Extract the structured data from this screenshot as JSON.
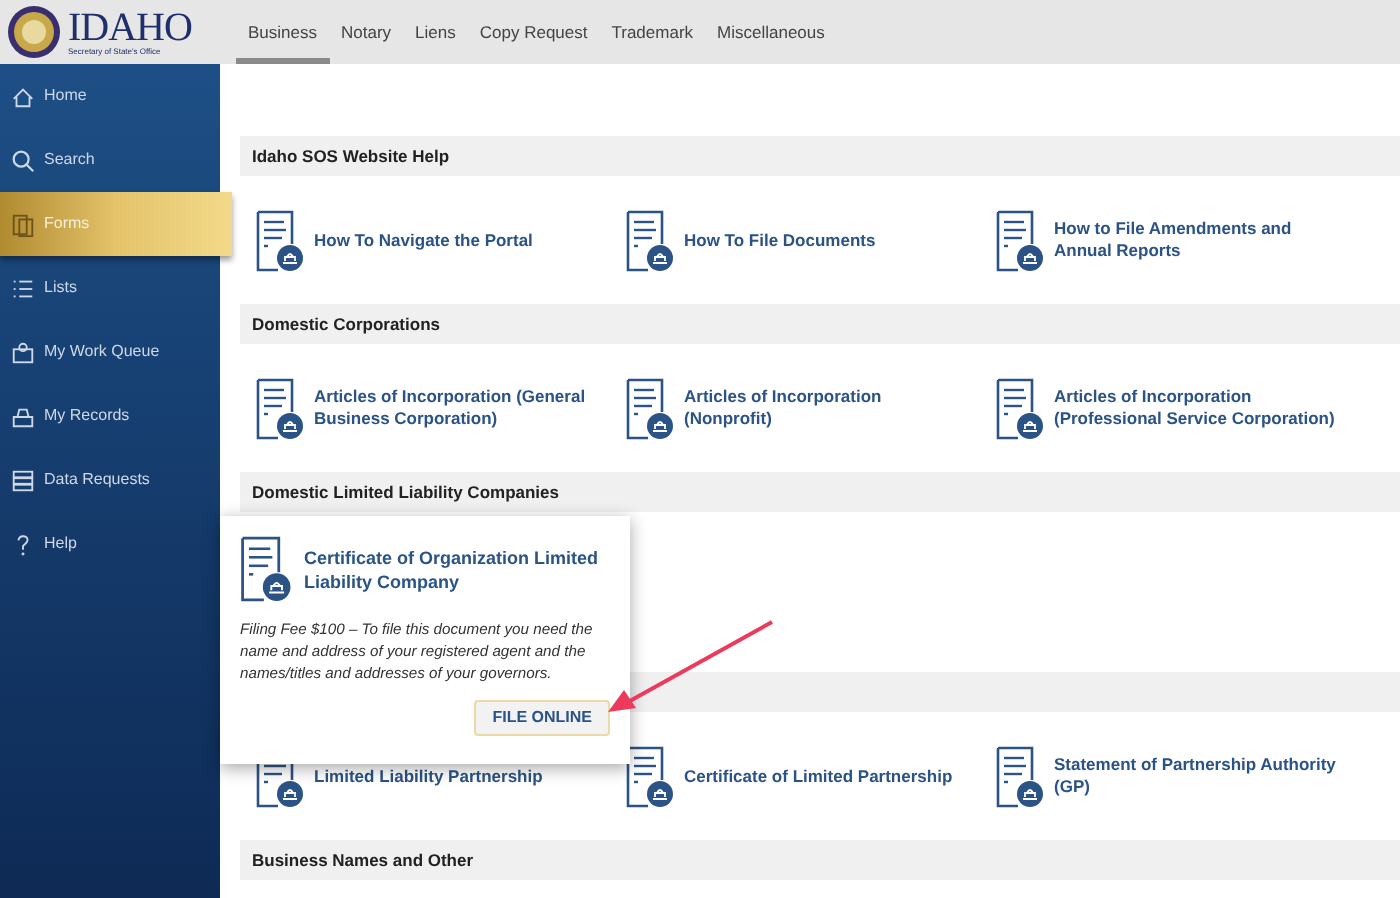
{
  "logo": {
    "name": "IDAHO",
    "subtitle": "Secretary of State's Office"
  },
  "tabs": [
    {
      "label": "Business",
      "selected": true
    },
    {
      "label": "Notary",
      "selected": false
    },
    {
      "label": "Liens",
      "selected": false
    },
    {
      "label": "Copy Request",
      "selected": false
    },
    {
      "label": "Trademark",
      "selected": false
    },
    {
      "label": "Miscellaneous",
      "selected": false
    }
  ],
  "sidebar": {
    "items": [
      {
        "label": "Home",
        "selected": false
      },
      {
        "label": "Search",
        "selected": false
      },
      {
        "label": "Forms",
        "selected": true
      },
      {
        "label": "Lists",
        "selected": false
      },
      {
        "label": "My Work Queue",
        "selected": false
      },
      {
        "label": "My Records",
        "selected": false
      },
      {
        "label": "Data Requests",
        "selected": false
      },
      {
        "label": "Help",
        "selected": false
      }
    ]
  },
  "sections": [
    {
      "title": "Idaho SOS Website Help",
      "items": [
        "How To Navigate the Portal",
        "How To File Documents",
        "How to File Amendments and Annual Reports"
      ]
    },
    {
      "title": "Domestic Corporations",
      "items": [
        "Articles of Incorporation (General Business Corporation)",
        "Articles of Incorporation (Nonprofit)",
        "Articles of Incorporation (Professional Service Corporation)"
      ]
    },
    {
      "title": "Domestic Limited Liability Companies"
    },
    {
      "items": [
        "Limited Liability Partnership",
        "Certificate of Limited Partnership",
        "Statement of Partnership Authority (GP)"
      ]
    },
    {
      "title": "Business Names and Other"
    }
  ],
  "popup": {
    "title": "Certificate of Organization Limited Liability Company",
    "description": "Filing Fee $100 – To file this document you need the name and address of your registered agent and the names/titles and addresses of your governors.",
    "button": "FILE ONLINE"
  }
}
